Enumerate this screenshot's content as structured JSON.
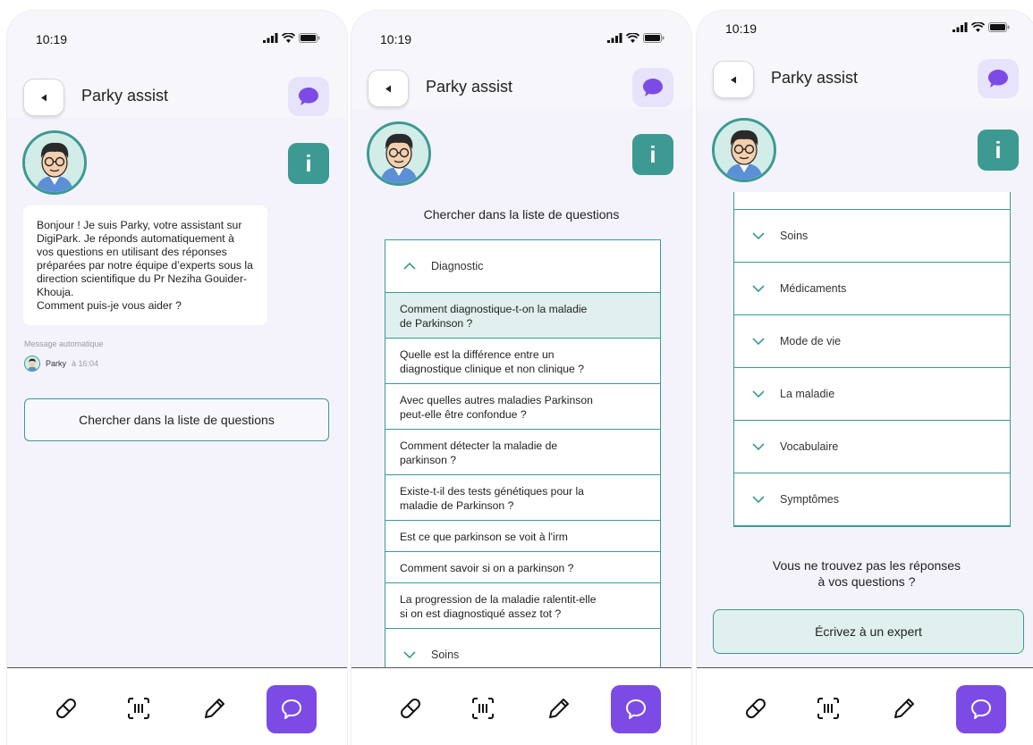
{
  "status": {
    "time": "10:19"
  },
  "header": {
    "title": "Parky assist"
  },
  "info_label": "i",
  "screen1": {
    "message": "Bonjour ! Je suis Parky, votre assistant sur DigiPark. Je réponds automatiquement à vos questions en utilisant des réponses préparées par notre équipe d’experts sous la direction scientifique du Pr Neziha Gouider-Khouja.\nComment puis-je vous aider ?",
    "auto_label": "Message automatique",
    "sender": "Parky",
    "sent_time": "à 16:04",
    "search_button": "Chercher dans la liste de questions"
  },
  "screen2": {
    "title": "Chercher dans la liste de questions",
    "open_category": "Diagnostic",
    "questions": [
      "Comment diagnostique-t-on la maladie\nde Parkinson ?",
      "Quelle est la différence entre un\ndiagnostique clinique et non clinique ?",
      "Avec quelles autres maladies Parkinson\npeut-elle être confondue ?",
      "Comment détecter la maladie de\nparkinson ?",
      "Existe-t-il des tests génétiques pour la\nmaladie de Parkinson ?",
      "Est ce que parkinson se voit à l'irm",
      "Comment savoir si on a parkinson ?",
      "La progression de la maladie ralentit-elle\nsi on est diagnostiqué assez tot ?"
    ],
    "selected_index": 0,
    "next_category": "Soins"
  },
  "screen3": {
    "categories": [
      "Soins",
      "Médicaments",
      "Mode de vie",
      "La maladie",
      "Vocabulaire",
      "Symptômes"
    ],
    "not_found": "Vous ne trouvez pas les réponses\nà vos questions ?",
    "expert_button": "Écrivez à un expert"
  },
  "tabbar": {
    "tabs": [
      {
        "icon": "pill-icon"
      },
      {
        "icon": "barcode-scan-icon"
      },
      {
        "icon": "pencil-icon"
      },
      {
        "icon": "chat-bubble-icon",
        "active": true
      }
    ]
  },
  "colors": {
    "accent": "#3c9a92",
    "purple": "#7c4be6",
    "lavender": "#e6e3fb",
    "selected": "#dff0ee"
  }
}
